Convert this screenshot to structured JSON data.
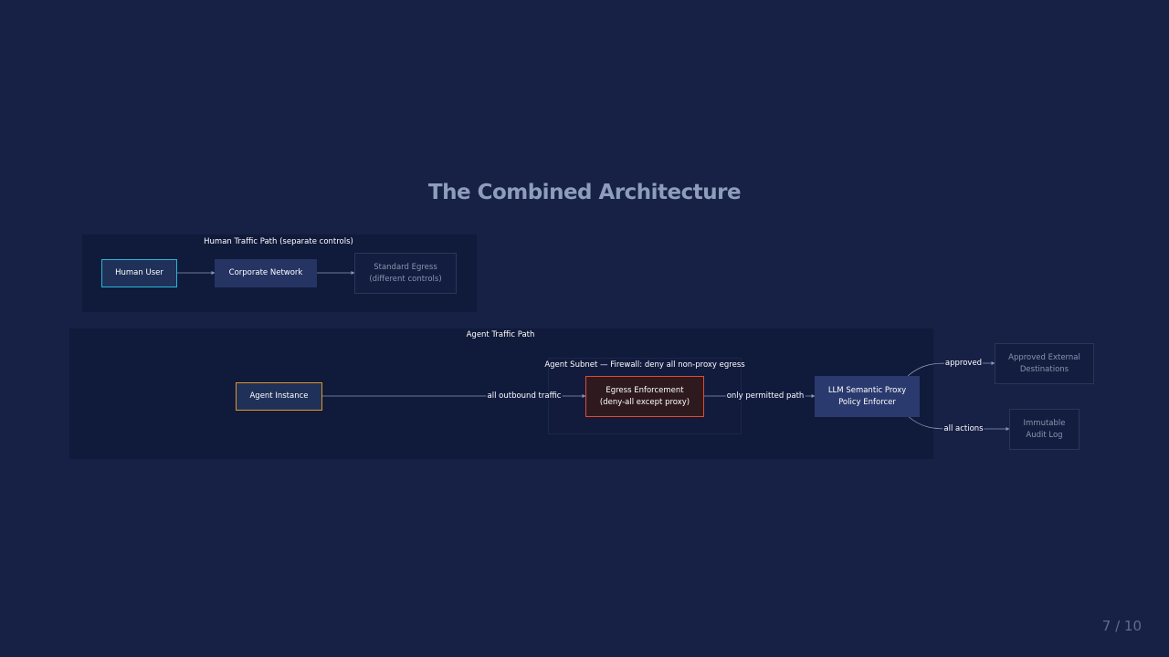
{
  "title": "The Combined Architecture",
  "page_number": "7 / 10",
  "human_path": {
    "label": "Human Traffic Path (separate controls)",
    "nodes": {
      "human_user": "Human User",
      "corporate_network": "Corporate Network",
      "standard_egress": "Standard Egress\n(different controls)"
    }
  },
  "agent_path": {
    "label": "Agent Traffic Path",
    "subnet_label": "Agent Subnet — Firewall: deny all non-proxy egress",
    "nodes": {
      "agent_instance": "Agent Instance",
      "egress_enforcement": "Egress Enforcement\n(deny-all except proxy)",
      "llm_proxy": "LLM Semantic Proxy\nPolicy Enforcer",
      "approved_destinations": "Approved External\nDestinations",
      "audit_log": "Immutable\nAudit Log"
    },
    "edges": {
      "all_outbound": "all outbound traffic",
      "only_permitted": "only permitted path",
      "approved": "approved",
      "all_actions": "all actions"
    }
  },
  "colors": {
    "background": "#172045",
    "human_user_border": "#2bb3d8",
    "agent_border": "#e0962a",
    "egress_border": "#e04a2e",
    "egress_fill": "#2e1a1e"
  }
}
